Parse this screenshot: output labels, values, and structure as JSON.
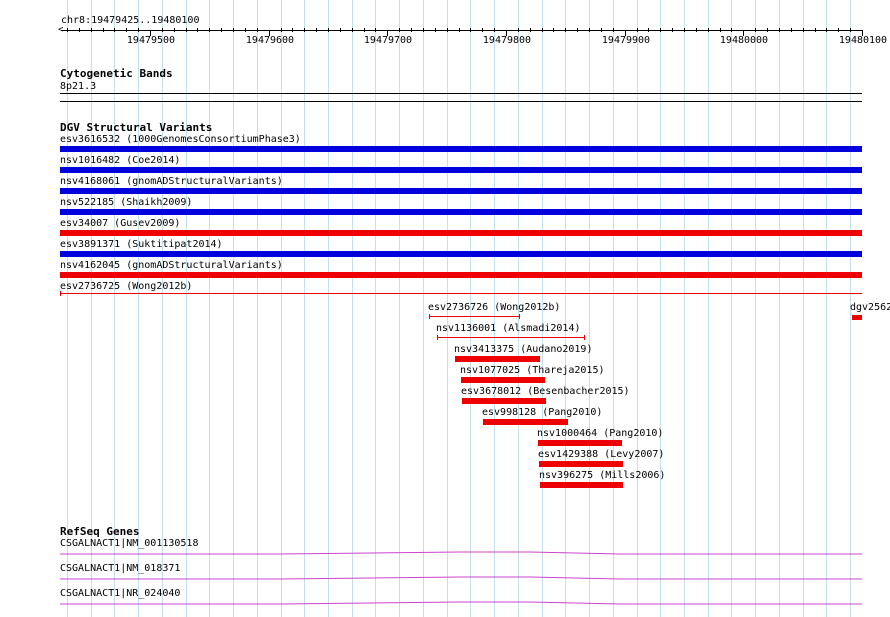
{
  "location": "chr8:19479425..19480100",
  "ruler": {
    "ticks": [
      "19479500",
      "19479600",
      "19479700",
      "19479800",
      "19479900",
      "19480000",
      "19480100"
    ]
  },
  "tracks": {
    "cytobands": {
      "title": "Cytogenetic Bands",
      "band": "8p21.3"
    },
    "dgv": {
      "title": "DGV Structural Variants",
      "colors": {
        "gain": "#0000dd",
        "loss": "#ee0000"
      },
      "full_rows": [
        {
          "label": "esv3616532 (1000GenomesConsortiumPhase3)",
          "type": "gain"
        },
        {
          "label": "nsv1016482 (Coe2014)",
          "type": "gain"
        },
        {
          "label": "nsv4168061 (gnomADStructuralVariants)",
          "type": "gain"
        },
        {
          "label": "nsv522185 (Shaikh2009)",
          "type": "gain"
        },
        {
          "label": "esv34007 (Gusev2009)",
          "type": "loss"
        },
        {
          "label": "esv3891371 (Suktitipat2014)",
          "type": "gain"
        },
        {
          "label": "nsv4162045 (gnomADStructuralVariants)",
          "type": "loss"
        },
        {
          "label": "esv2736725 (Wong2012b)",
          "type": "loss-thin"
        }
      ],
      "short_features": [
        {
          "label": "esv2736726 (Wong2012b)",
          "start": 19479735,
          "end": 19479811,
          "style": "thin"
        },
        {
          "label": "nsv1136001 (Alsmadi2014)",
          "start": 19479742,
          "end": 19479866,
          "style": "thin"
        },
        {
          "label": "nsv3413375 (Audano2019)",
          "start": 19479757,
          "end": 19479829,
          "style": "thick"
        },
        {
          "label": "nsv1077025 (Thareja2015)",
          "start": 19479762,
          "end": 19479833,
          "style": "thick"
        },
        {
          "label": "esv3678012 (Besenbacher2015)",
          "start": 19479763,
          "end": 19479834,
          "style": "thick"
        },
        {
          "label": "esv998128 (Pang2010)",
          "start": 19479781,
          "end": 19479852,
          "style": "thick"
        },
        {
          "label": "nsv1000464 (Pang2010)",
          "start": 19479827,
          "end": 19479898,
          "style": "thick"
        },
        {
          "label": "esv1429388 (Levy2007)",
          "start": 19479828,
          "end": 19479899,
          "style": "thick"
        },
        {
          "label": "nsv396275 (Mills2006)",
          "start": 19479829,
          "end": 19479899,
          "style": "thick"
        }
      ],
      "edge_feature": {
        "label": "dgv2562"
      }
    },
    "refseq": {
      "title": "RefSeq Genes",
      "color": "#cc44cc",
      "genes": [
        {
          "label": "CSGALNACT1|NM_001130518"
        },
        {
          "label": "CSGALNACT1|NM_018371"
        },
        {
          "label": "CSGALNACT1|NR_024040"
        }
      ]
    }
  }
}
